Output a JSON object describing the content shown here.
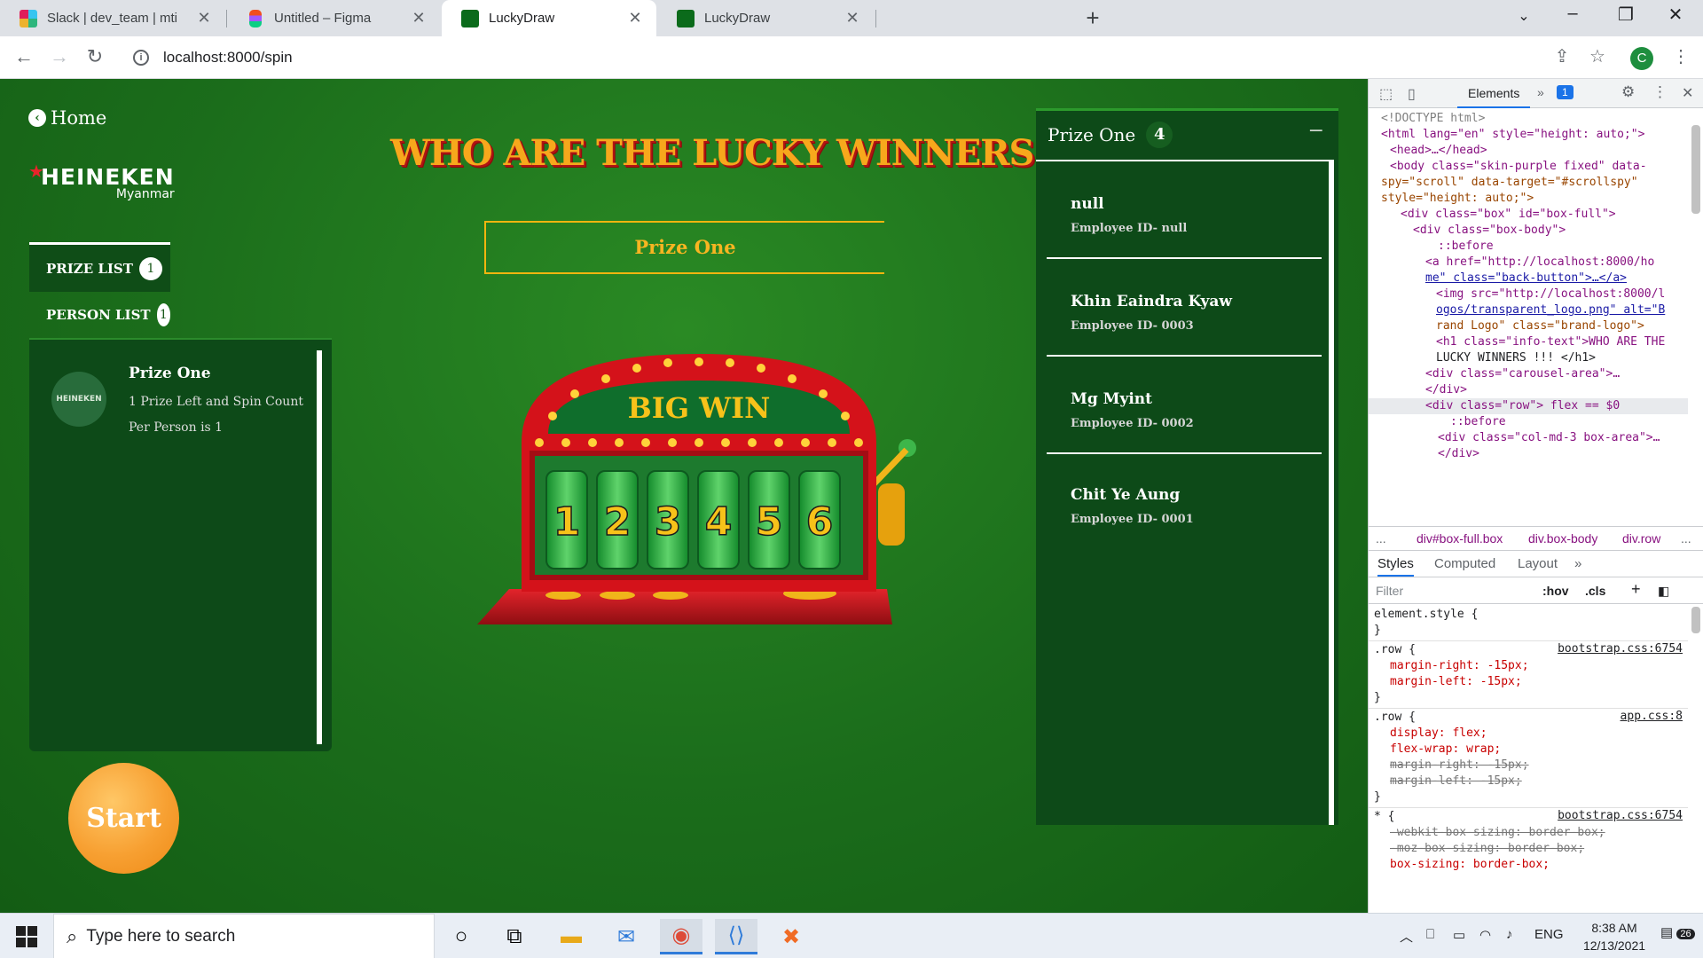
{
  "browser": {
    "tabs": [
      {
        "label": "Slack | dev_team | mti",
        "favicon": "slack-icon",
        "color": "#e01e5a"
      },
      {
        "label": "Untitled – Figma",
        "favicon": "figma-icon",
        "color": "#f24e1e"
      },
      {
        "label": "LuckyDraw",
        "favicon": "luckydraw-icon",
        "color": "#0b6b1b",
        "active": true
      },
      {
        "label": "LuckyDraw",
        "favicon": "luckydraw-icon",
        "color": "#0b6b1b"
      }
    ],
    "url": "localhost:8000/spin",
    "profile_initial": "C"
  },
  "app": {
    "home_label": "Home",
    "brand": {
      "name": "HEINEKEN",
      "sub": "Myanmar"
    },
    "tabs": [
      {
        "label": "PRIZE LIST",
        "count": "1"
      },
      {
        "label": "PERSON LIST",
        "count": "1"
      }
    ],
    "prize_item": {
      "logo_text": "HEINEKEN",
      "title": "Prize One",
      "desc": "1 Prize Left and Spin Count Per Person is 1"
    },
    "start_label": "Start",
    "headline": "WHO ARE THE LUCKY WINNERS !!!",
    "selected_prize": "Prize One",
    "machine": {
      "sign": "BIG WIN",
      "reels": [
        "1",
        "2",
        "3",
        "4",
        "5",
        "6"
      ]
    },
    "winners_panel": {
      "title": "Prize One",
      "count": "4",
      "winners": [
        {
          "name": "null",
          "id": "Employee ID- null"
        },
        {
          "name": "Khin Eaindra Kyaw",
          "id": "Employee ID- 0003"
        },
        {
          "name": "Mg Myint",
          "id": "Employee ID- 0002"
        },
        {
          "name": "Chit Ye Aung",
          "id": "Employee ID- 0001"
        }
      ]
    },
    "colors": {
      "bg_green": "#1b6d1b",
      "panel": "#0d4a18",
      "gold": "#f7a81c",
      "start_orange": "#f7a032"
    }
  },
  "devtools": {
    "top_tab": "Elements",
    "issues": "1",
    "dom": [
      "<!DOCTYPE html>",
      "<html lang=\"en\" style=\"height: auto;\">",
      "<head>…</head>",
      "<body class=\"skin-purple fixed\" data-",
      "spy=\"scroll\" data-target=\"#scrollspy\"",
      "style=\"height: auto;\">",
      "<div class=\"box\" id=\"box-full\">",
      "<div class=\"box-body\">",
      "::before",
      "<a href=\"http://localhost:8000/ho",
      "me\" class=\"back-button\">…</a>",
      "<img src=\"http://localhost:8000/l",
      "ogos/transparent_logo.png\" alt=\"B",
      "rand Logo\" class=\"brand-logo\">",
      "<h1 class=\"info-text\">WHO ARE THE",
      "LUCKY WINNERS !!! </h1>",
      "<div class=\"carousel-area\">…",
      "</div>",
      "<div class=\"row\"> flex == $0",
      "::before",
      "<div class=\"col-md-3 box-area\">…",
      "</div>"
    ],
    "breadcrumbs": [
      "...",
      "div#box-full.box",
      "div.box-body",
      "div.row",
      "..."
    ],
    "style_tabs": [
      "Styles",
      "Computed",
      "Layout",
      "»"
    ],
    "filter_placeholder": "Filter",
    "filter_tools": [
      ":hov",
      ".cls",
      "+"
    ],
    "rules": [
      "element.style {",
      "}",
      ".row {",
      "margin-right: -15px;",
      "margin-left: -15px;",
      "}",
      ".row {",
      "display: flex;",
      "flex-wrap: wrap;",
      "margin-right: -15px;",
      "margin-left: -15px;",
      "}",
      "* {",
      "-webkit-box-sizing: border-box;",
      "-moz-box-sizing: border-box;",
      "box-sizing: border-box;"
    ],
    "sources": [
      "bootstrap.css:6754",
      "app.css:8",
      "bootstrap.css:6754"
    ]
  },
  "taskbar": {
    "search_placeholder": "Type here to search",
    "lang": "ENG",
    "time": "8:38 AM",
    "date": "12/13/2021",
    "notifications": "26"
  }
}
